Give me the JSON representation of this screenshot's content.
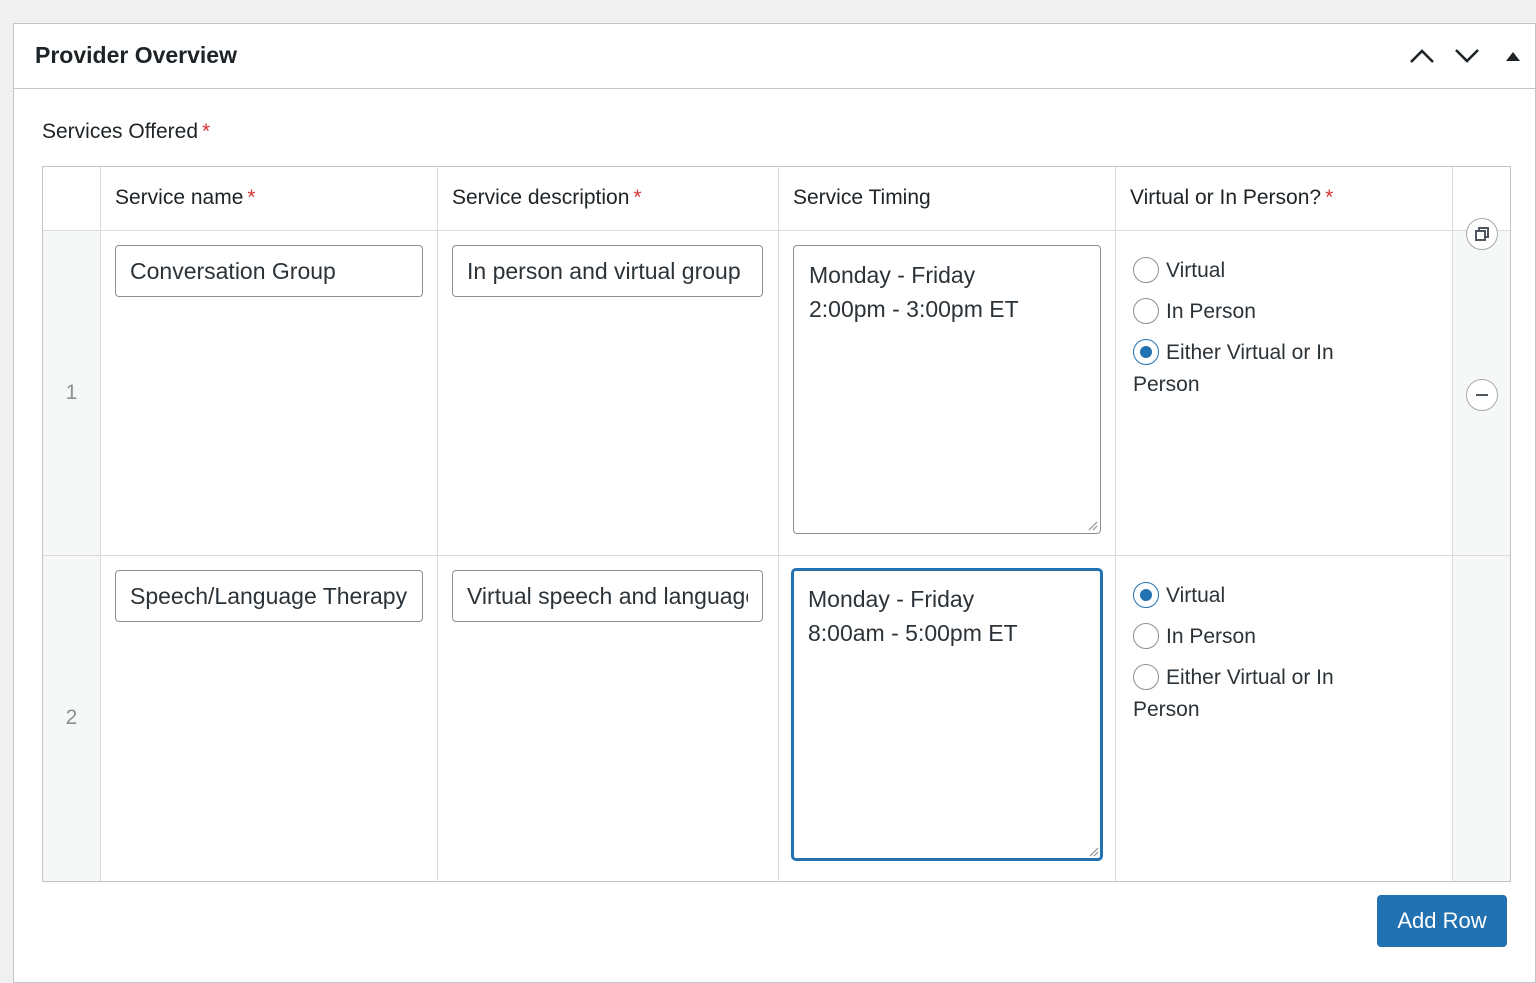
{
  "panel": {
    "title": "Provider Overview",
    "controls": [
      "move-up-icon",
      "move-down-icon",
      "toggle-panel-icon"
    ]
  },
  "field": {
    "label": "Services Offered",
    "required_mark": "*"
  },
  "table": {
    "headers": [
      {
        "label": "Service name",
        "required": "*"
      },
      {
        "label": "Service description",
        "required": "*"
      },
      {
        "label": "Service Timing",
        "required": ""
      },
      {
        "label": "Virtual or In Person?",
        "required": "*"
      }
    ],
    "rows": [
      {
        "number": "1",
        "service_name": "Conversation Group",
        "service_description": "In person and virtual group conversation",
        "service_timing": "Monday - Friday\n2:00pm - 3:00pm ET",
        "options": [
          "Virtual",
          "In Person",
          "Either Virtual or In",
          "Person"
        ],
        "selected": "Either Virtual or In Person"
      },
      {
        "number": "2",
        "service_name": "Speech/Language Therapy",
        "service_description": "Virtual speech and language therapy",
        "service_timing": "Monday - Friday\n8:00am - 5:00pm ET\n",
        "options": [
          "Virtual",
          "In Person",
          "Either Virtual or In",
          "Person"
        ],
        "selected": "Virtual"
      }
    ]
  },
  "actions": {
    "add_row": "Add Row"
  },
  "colors": {
    "primary": "#2271b1",
    "required": "#d63638",
    "border": "#c3c4c7"
  }
}
